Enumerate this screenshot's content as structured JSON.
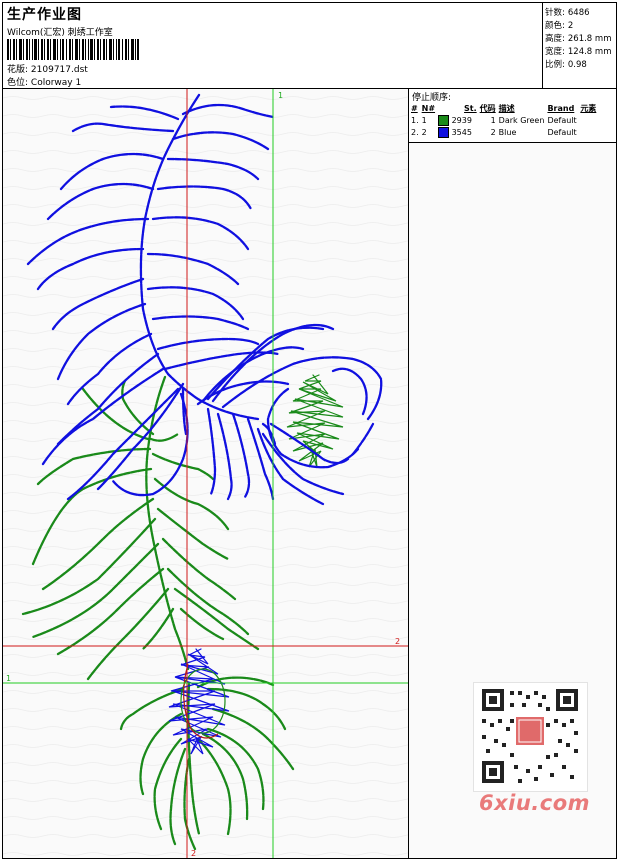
{
  "header": {
    "title": "生产作业图",
    "studio": "Wilcom(汇宏) 刺绣工作室",
    "design_label": "花版:",
    "design_value": "2109717.dst",
    "colorway_label": "色位:",
    "colorway_value": "Colorway 1"
  },
  "stats": [
    {
      "label": "针数:",
      "value": "6486"
    },
    {
      "label": "颜色:",
      "value": "2"
    },
    {
      "label": "高度:",
      "value": "261.8 mm"
    },
    {
      "label": "宽度:",
      "value": "124.8 mm"
    },
    {
      "label": "比例:",
      "value": "0.98"
    }
  ],
  "stop_sequence": {
    "title": "停止顺序:",
    "columns": [
      "#",
      "N#",
      "St.",
      "代码",
      "描述",
      "Brand",
      "元素"
    ],
    "rows": [
      {
        "idx": "1.",
        "n": "1",
        "color": "#1a8a1a",
        "st": "2939",
        "code": "1",
        "desc": "Dark Green",
        "brand": "Default"
      },
      {
        "idx": "2.",
        "n": "2",
        "color": "#1010e0",
        "st": "3545",
        "code": "2",
        "desc": "Blue",
        "brand": "Default"
      }
    ]
  },
  "guides": {
    "v_red_label": "2",
    "v_green_label": "1",
    "h_red_label": "2",
    "h_green_label": "1"
  },
  "colors": {
    "green_thread": "#1a8a1a",
    "blue_thread": "#1010e0",
    "guide_red": "#d01818",
    "guide_green": "#22cc22",
    "watermark": "#e97a7a"
  },
  "watermark_text": "6xiu.com"
}
